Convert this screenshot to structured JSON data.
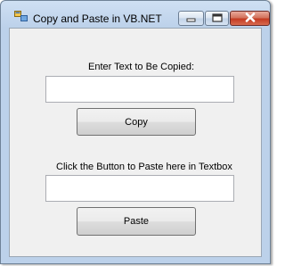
{
  "window": {
    "title": "Copy and Paste in VB.NET"
  },
  "titlebar": {
    "icon": "form-icon",
    "minimize_icon": "minimize-icon",
    "maximize_icon": "maximize-icon",
    "close_icon": "close-icon"
  },
  "form": {
    "copy_label": "Enter Text to Be Copied:",
    "copy_textbox_value": "",
    "copy_button_label": "Copy",
    "paste_label": "Click the Button to Paste here in Textbox",
    "paste_textbox_value": "",
    "paste_button_label": "Paste"
  },
  "colors": {
    "titlebar": "#bcd1ea",
    "client_background": "#f0f0f0",
    "close_button": "#c43c23"
  }
}
